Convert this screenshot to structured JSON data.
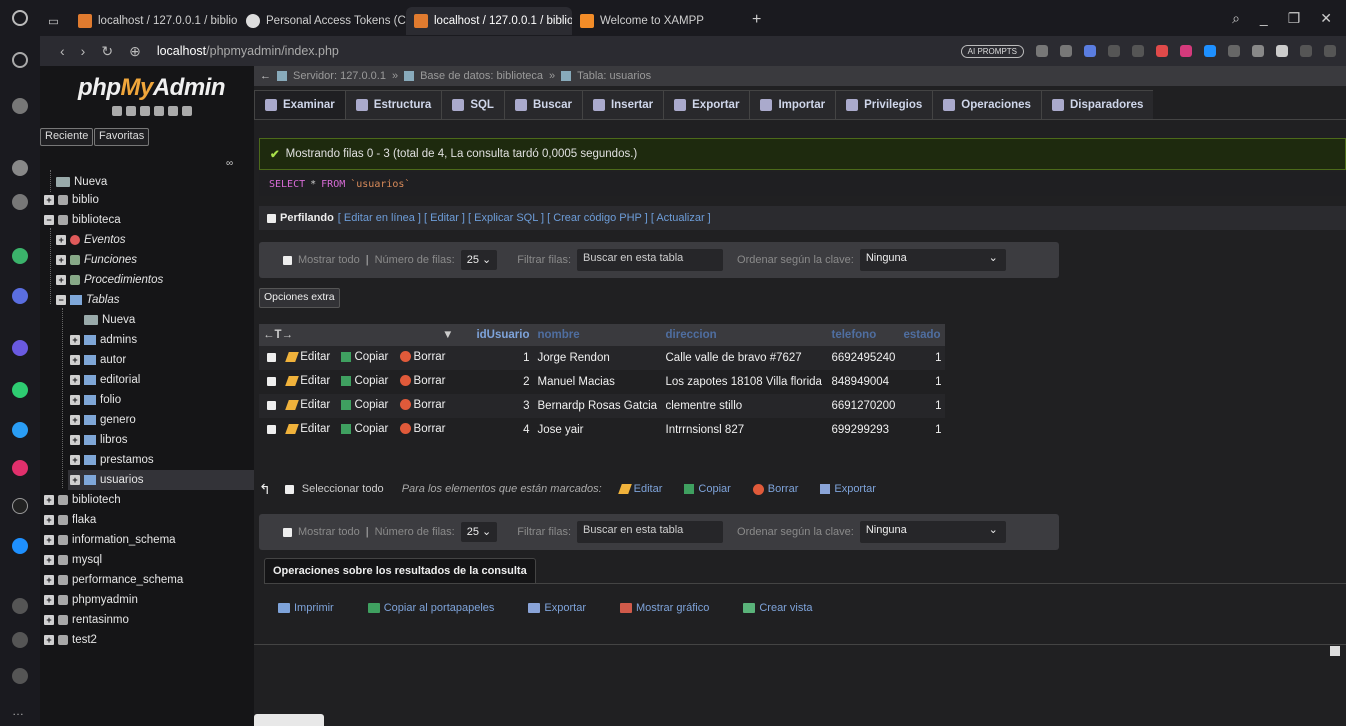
{
  "browser": {
    "tabs": [
      {
        "label": "localhost / 127.0.0.1 / biblio",
        "active": false
      },
      {
        "label": "Personal Access Tokens (Cl",
        "active": false
      },
      {
        "label": "localhost / 127.0.0.1 / biblio",
        "active": true
      },
      {
        "label": "Welcome to XAMPP",
        "active": false
      }
    ],
    "url_host": "localhost",
    "url_path": "/phpmyadmin/index.php",
    "ai_prompts": "AI PROMPTS"
  },
  "nav": {
    "logo_php": "php",
    "logo_my": "My",
    "logo_admin": "Admin",
    "recent": "Reciente",
    "favorites": "Favoritas",
    "tree": [
      {
        "label": "Nueva",
        "level": 1,
        "icon": "new"
      },
      {
        "label": "biblio",
        "level": 0,
        "icon": "db"
      },
      {
        "label": "biblioteca",
        "level": 0,
        "icon": "db"
      },
      {
        "label": "Eventos",
        "level": 1,
        "icon": "events",
        "italic": true
      },
      {
        "label": "Funciones",
        "level": 1,
        "icon": "functions",
        "italic": true
      },
      {
        "label": "Procedimientos",
        "level": 1,
        "icon": "procedures",
        "italic": true
      },
      {
        "label": "Tablas",
        "level": 1,
        "icon": "tables",
        "italic": true
      },
      {
        "label": "Nueva",
        "level": 2,
        "icon": "new"
      },
      {
        "label": "admins",
        "level": 2,
        "icon": "table"
      },
      {
        "label": "autor",
        "level": 2,
        "icon": "table"
      },
      {
        "label": "editorial",
        "level": 2,
        "icon": "table"
      },
      {
        "label": "folio",
        "level": 2,
        "icon": "table"
      },
      {
        "label": "genero",
        "level": 2,
        "icon": "table"
      },
      {
        "label": "libros",
        "level": 2,
        "icon": "table"
      },
      {
        "label": "prestamos",
        "level": 2,
        "icon": "table"
      },
      {
        "label": "usuarios",
        "level": 2,
        "icon": "table",
        "selected": true
      },
      {
        "label": "bibliotech",
        "level": 0,
        "icon": "db"
      },
      {
        "label": "flaka",
        "level": 0,
        "icon": "db"
      },
      {
        "label": "information_schema",
        "level": 0,
        "icon": "db"
      },
      {
        "label": "mysql",
        "level": 0,
        "icon": "db"
      },
      {
        "label": "performance_schema",
        "level": 0,
        "icon": "db"
      },
      {
        "label": "phpmyadmin",
        "level": 0,
        "icon": "db"
      },
      {
        "label": "rentasinmo",
        "level": 0,
        "icon": "db"
      },
      {
        "label": "test2",
        "level": 0,
        "icon": "db"
      }
    ]
  },
  "breadcrumb": {
    "server": "Servidor: 127.0.0.1",
    "database": "Base de datos: biblioteca",
    "table": "Tabla: usuarios",
    "sep": "»"
  },
  "menu": [
    "Examinar",
    "Estructura",
    "SQL",
    "Buscar",
    "Insertar",
    "Exportar",
    "Importar",
    "Privilegios",
    "Operaciones",
    "Disparadores"
  ],
  "message": "Mostrando filas 0 - 3 (total de 4, La consulta tardó 0,0005 segundos.)",
  "sql": {
    "select": "SELECT",
    "star": "*",
    "from": "FROM",
    "table": "`usuarios`"
  },
  "profiling": {
    "label": "Perfilando",
    "links": "[ Editar en línea ] [ Editar ] [ Explicar SQL ] [ Crear código PHP ] [ Actualizar ]"
  },
  "controls": {
    "show_all": "Mostrar todo",
    "rows_label": "Número de filas:",
    "rows_value": "25",
    "filter_label": "Filtrar filas:",
    "search_placeholder": "Buscar en esta tabla",
    "order_label": "Ordenar según la clave:",
    "order_value": "Ninguna"
  },
  "extra_options": "Opciones extra",
  "table": {
    "arrows": "←T→",
    "columns": [
      "idUsuario",
      "nombre",
      "direccion",
      "telefono",
      "estado"
    ],
    "actions": {
      "edit": "Editar",
      "copy": "Copiar",
      "delete": "Borrar"
    },
    "rows": [
      {
        "idUsuario": "1",
        "nombre": "Jorge Rendon",
        "direccion": "Calle valle de bravo #7627",
        "telefono": "6692495240",
        "estado": "1"
      },
      {
        "idUsuario": "2",
        "nombre": "Manuel Macias",
        "direccion": "Los zapotes 18108 Villa florida",
        "telefono": "848949004",
        "estado": "1"
      },
      {
        "idUsuario": "3",
        "nombre": "Bernardp Rosas Gatcia",
        "direccion": "clementre stillo",
        "telefono": "6691270200",
        "estado": "1"
      },
      {
        "idUsuario": "4",
        "nombre": "Jose yair",
        "direccion": "Intrrnsionsl 827",
        "telefono": "699299293",
        "estado": "1"
      }
    ]
  },
  "mass": {
    "select_all": "Seleccionar todo",
    "for_marked": "Para los elementos que están marcados:",
    "edit": "Editar",
    "copy": "Copiar",
    "delete": "Borrar",
    "export": "Exportar"
  },
  "results_ops": {
    "title": "Operaciones sobre los resultados de la consulta",
    "print": "Imprimir",
    "clipboard": "Copiar al portapapeles",
    "export": "Exportar",
    "chart": "Mostrar gráfico",
    "view": "Crear vista"
  }
}
